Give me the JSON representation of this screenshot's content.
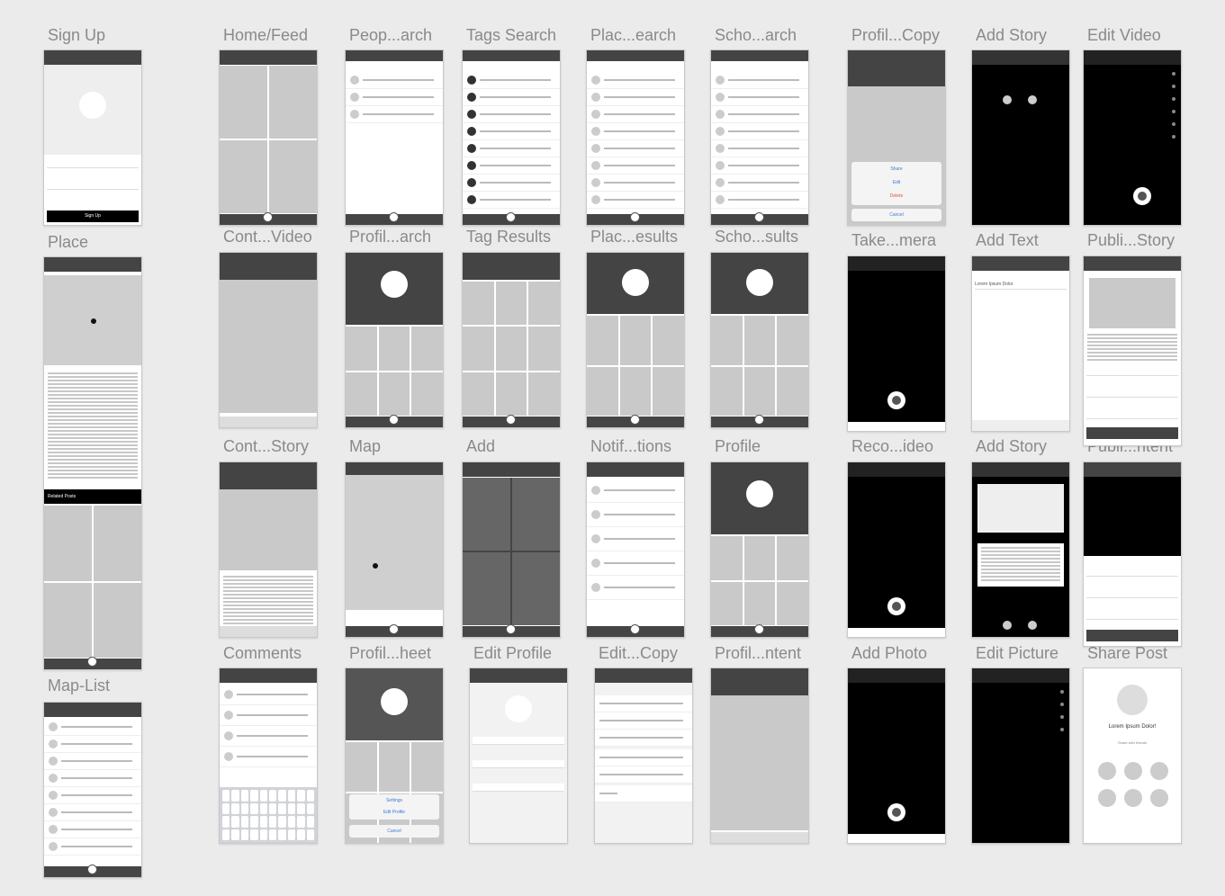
{
  "labels": {
    "sign_up": "Sign Up",
    "place": "Place",
    "map_list": "Map-List",
    "home_feed": "Home/Feed",
    "cont_video": "Cont...Video",
    "cont_story": "Cont...Story",
    "comments": "Comments",
    "people_search": "Peop...arch",
    "profil_arch": "Profil...arch",
    "map": "Map",
    "profil_heet": "Profil...heet",
    "tags_search": "Tags Search",
    "tag_results": "Tag Results",
    "add": "Add",
    "edit_profile": "Edit Profile",
    "place_search": "Plac...earch",
    "place_results": "Plac...esults",
    "notifications": "Notif...tions",
    "edit_copy": "Edit...Copy",
    "school_search": "Scho...arch",
    "school_results": "Scho...sults",
    "profile": "Profile",
    "profil_ntent": "Profil...ntent",
    "profil_copy": "Profil...Copy",
    "take_camera": "Take...mera",
    "record_video": "Reco...ideo",
    "add_photo": "Add Photo",
    "add_story": "Add Story",
    "add_text": "Add Text",
    "add_story_2": "Add Story",
    "edit_picture": "Edit Picture",
    "edit_video": "Edit Video",
    "publish_story": "Publi...Story",
    "publish_content": "Publi...ntent",
    "share_post": "Share Post"
  },
  "screens": {
    "share_post_text": "Lorem Ipsum Dolor!",
    "share_post_sub": "Share with friends",
    "add_text_input": "Lorem Ipsum Dolor",
    "related_posts": "Related Posts",
    "sheet_share": "Share",
    "sheet_edit": "Edit",
    "sheet_delete": "Delete",
    "sheet_cancel": "Cancel",
    "settings": "Settings",
    "edit_profile_btn": "Edit Profile",
    "signup_button": "Sign Up"
  },
  "colors": {
    "canvas": "#ebebeb",
    "header": "#444444",
    "placeholder": "#c9c9c9",
    "delete": "#d9534f",
    "link": "#3a7bd5"
  }
}
